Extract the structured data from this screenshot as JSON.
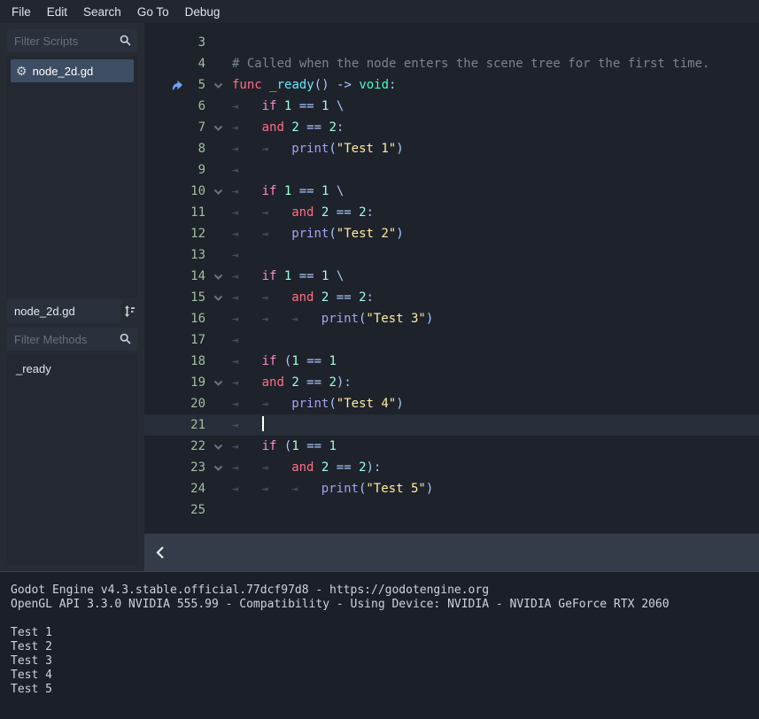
{
  "menubar": {
    "items": [
      "File",
      "Edit",
      "Search",
      "Go To",
      "Debug"
    ]
  },
  "sidebar": {
    "filter_scripts_placeholder": "Filter Scripts",
    "scripts": [
      {
        "label": "node_2d.gd",
        "selected": true
      }
    ],
    "script_name_value": "node_2d.gd",
    "filter_methods_placeholder": "Filter Methods",
    "methods": [
      "_ready"
    ]
  },
  "editor": {
    "lines": [
      {
        "n": "3",
        "tabs": 0,
        "fold": false,
        "override": false,
        "current": false,
        "tokens": []
      },
      {
        "n": "4",
        "tabs": 0,
        "fold": false,
        "override": false,
        "current": false,
        "tokens": [
          [
            "com",
            "# Called when the node enters the scene tree for the first time."
          ]
        ]
      },
      {
        "n": "5",
        "tabs": 0,
        "fold": true,
        "override": true,
        "current": false,
        "tokens": [
          [
            "kw",
            "func "
          ],
          [
            "fndef",
            "_ready"
          ],
          [
            "sym",
            "() -> "
          ],
          [
            "typ",
            "void"
          ],
          [
            "sym",
            ":"
          ]
        ]
      },
      {
        "n": "6",
        "tabs": 1,
        "fold": false,
        "override": false,
        "current": false,
        "tokens": [
          [
            "cf",
            "if "
          ],
          [
            "num",
            "1"
          ],
          [
            "sym",
            " == "
          ],
          [
            "num",
            "1"
          ],
          [
            "sym",
            " \\"
          ]
        ]
      },
      {
        "n": "7",
        "tabs": 1,
        "fold": true,
        "override": false,
        "current": false,
        "tokens": [
          [
            "kw",
            "and "
          ],
          [
            "num",
            "2"
          ],
          [
            "sym",
            " == "
          ],
          [
            "num",
            "2"
          ],
          [
            "sym",
            ":"
          ]
        ]
      },
      {
        "n": "8",
        "tabs": 2,
        "fold": false,
        "override": false,
        "current": false,
        "tokens": [
          [
            "gfn",
            "print"
          ],
          [
            "sym",
            "("
          ],
          [
            "str",
            "\"Test 1\""
          ],
          [
            "sym",
            ")"
          ]
        ]
      },
      {
        "n": "9",
        "tabs": 1,
        "fold": false,
        "override": false,
        "current": false,
        "tokens": []
      },
      {
        "n": "10",
        "tabs": 1,
        "fold": true,
        "override": false,
        "current": false,
        "tokens": [
          [
            "cf",
            "if "
          ],
          [
            "num",
            "1"
          ],
          [
            "sym",
            " == "
          ],
          [
            "num",
            "1"
          ],
          [
            "sym",
            " \\"
          ]
        ]
      },
      {
        "n": "11",
        "tabs": 2,
        "fold": false,
        "override": false,
        "current": false,
        "tokens": [
          [
            "kw",
            "and "
          ],
          [
            "num",
            "2"
          ],
          [
            "sym",
            " == "
          ],
          [
            "num",
            "2"
          ],
          [
            "sym",
            ":"
          ]
        ]
      },
      {
        "n": "12",
        "tabs": 2,
        "fold": false,
        "override": false,
        "current": false,
        "tokens": [
          [
            "gfn",
            "print"
          ],
          [
            "sym",
            "("
          ],
          [
            "str",
            "\"Test 2\""
          ],
          [
            "sym",
            ")"
          ]
        ]
      },
      {
        "n": "13",
        "tabs": 1,
        "fold": false,
        "override": false,
        "current": false,
        "tokens": []
      },
      {
        "n": "14",
        "tabs": 1,
        "fold": true,
        "override": false,
        "current": false,
        "tokens": [
          [
            "cf",
            "if "
          ],
          [
            "num",
            "1"
          ],
          [
            "sym",
            " == "
          ],
          [
            "num",
            "1"
          ],
          [
            "sym",
            " \\"
          ]
        ]
      },
      {
        "n": "15",
        "tabs": 2,
        "fold": true,
        "override": false,
        "current": false,
        "tokens": [
          [
            "kw",
            "and "
          ],
          [
            "num",
            "2"
          ],
          [
            "sym",
            " == "
          ],
          [
            "num",
            "2"
          ],
          [
            "sym",
            ":"
          ]
        ]
      },
      {
        "n": "16",
        "tabs": 3,
        "fold": false,
        "override": false,
        "current": false,
        "tokens": [
          [
            "gfn",
            "print"
          ],
          [
            "sym",
            "("
          ],
          [
            "str",
            "\"Test 3\""
          ],
          [
            "sym",
            ")"
          ]
        ]
      },
      {
        "n": "17",
        "tabs": 1,
        "fold": false,
        "override": false,
        "current": false,
        "tokens": []
      },
      {
        "n": "18",
        "tabs": 1,
        "fold": false,
        "override": false,
        "current": false,
        "tokens": [
          [
            "cf",
            "if "
          ],
          [
            "sym",
            "("
          ],
          [
            "num",
            "1"
          ],
          [
            "sym",
            " == "
          ],
          [
            "num",
            "1"
          ]
        ]
      },
      {
        "n": "19",
        "tabs": 1,
        "fold": true,
        "override": false,
        "current": false,
        "tokens": [
          [
            "kw",
            "and "
          ],
          [
            "num",
            "2"
          ],
          [
            "sym",
            " == "
          ],
          [
            "num",
            "2"
          ],
          [
            "sym",
            "):"
          ]
        ]
      },
      {
        "n": "20",
        "tabs": 2,
        "fold": false,
        "override": false,
        "current": false,
        "tokens": [
          [
            "gfn",
            "print"
          ],
          [
            "sym",
            "("
          ],
          [
            "str",
            "\"Test 4\""
          ],
          [
            "sym",
            ")"
          ]
        ]
      },
      {
        "n": "21",
        "tabs": 1,
        "fold": false,
        "override": false,
        "current": true,
        "tokens": []
      },
      {
        "n": "22",
        "tabs": 1,
        "fold": true,
        "override": false,
        "current": false,
        "tokens": [
          [
            "cf",
            "if "
          ],
          [
            "sym",
            "("
          ],
          [
            "num",
            "1"
          ],
          [
            "sym",
            " == "
          ],
          [
            "num",
            "1"
          ]
        ]
      },
      {
        "n": "23",
        "tabs": 2,
        "fold": true,
        "override": false,
        "current": false,
        "tokens": [
          [
            "kw",
            "and "
          ],
          [
            "num",
            "2"
          ],
          [
            "sym",
            " == "
          ],
          [
            "num",
            "2"
          ],
          [
            "sym",
            "):"
          ]
        ]
      },
      {
        "n": "24",
        "tabs": 3,
        "fold": false,
        "override": false,
        "current": false,
        "tokens": [
          [
            "gfn",
            "print"
          ],
          [
            "sym",
            "("
          ],
          [
            "str",
            "\"Test 5\""
          ],
          [
            "sym",
            ")"
          ]
        ]
      },
      {
        "n": "25",
        "tabs": 0,
        "fold": false,
        "override": false,
        "current": false,
        "tokens": []
      }
    ]
  },
  "bottom_bar": {
    "collapse_icon": "chevron-left"
  },
  "output": {
    "lines": [
      "Godot Engine v4.3.stable.official.77dcf97d8 - https://godotengine.org",
      "OpenGL API 3.3.0 NVIDIA 555.99 - Compatibility - Using Device: NVIDIA - NVIDIA GeForce RTX 2060",
      "",
      "Test 1",
      "Test 2",
      "Test 3",
      "Test 4",
      "Test 5"
    ]
  },
  "colors": {
    "editor_bg": "#1e222b",
    "current_line_bg": "#272d39",
    "selection_item_bg": "#3d4d63",
    "keyword": "#ff7085",
    "control_flow_keyword": "#ff8ccc",
    "number": "#a1ffe0",
    "symbol": "#abc9ff",
    "string": "#ffeda1",
    "comment": "#7b838f",
    "function_definition": "#66e6ff",
    "global_function": "#a3a3f5",
    "base_type": "#42ffc2",
    "safe_line_number": "#a3bfa0",
    "override_icon_blue": "#6ea2f3"
  }
}
